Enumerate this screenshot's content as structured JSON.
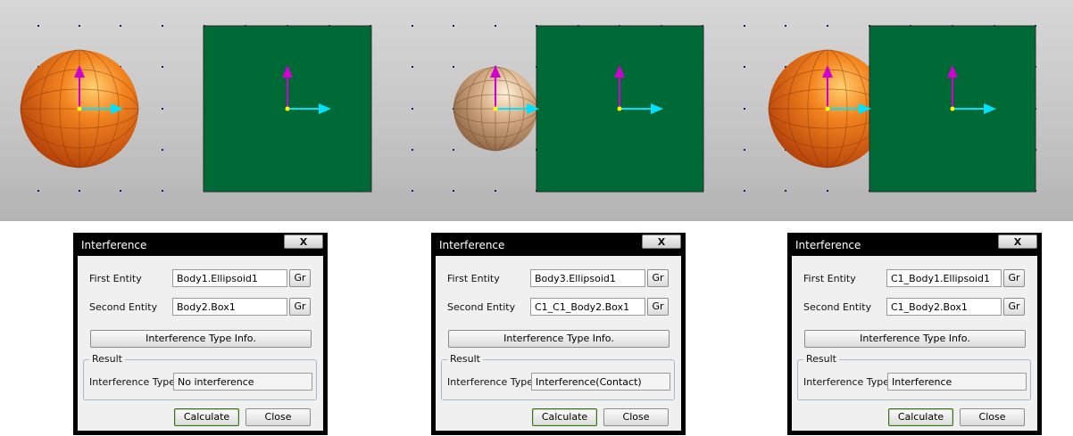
{
  "scene": {
    "colors": {
      "background_top": "#d7d7d7",
      "background_bottom": "#b3b3b3",
      "box_fill": "#006a37",
      "sphere_orange": "#e8681a",
      "sphere_tan": "#caa27a",
      "axis_x": "#00e0ff",
      "axis_y": "#d000d0",
      "origin": "#ffff00",
      "grid_dot": "#1a1a6a"
    },
    "panels": [
      {
        "name": "no-interference",
        "sphere_color": "orange",
        "relation": "separated"
      },
      {
        "name": "contact",
        "sphere_color": "tan",
        "relation": "touching"
      },
      {
        "name": "interference",
        "sphere_color": "orange",
        "relation": "overlapping"
      }
    ]
  },
  "dialogs": [
    {
      "title": "Interference",
      "close_label": "X",
      "first_entity_label": "First Entity",
      "first_entity_value": "Body1.Ellipsoid1",
      "second_entity_label": "Second Entity",
      "second_entity_value": "Body2.Box1",
      "gr_label": "Gr",
      "type_info_label": "Interference Type Info.",
      "result_legend": "Result",
      "interference_type_label": "Interference Type",
      "interference_type_value": "No interference",
      "calculate_label": "Calculate",
      "close_button_label": "Close"
    },
    {
      "title": "Interference",
      "close_label": "X",
      "first_entity_label": "First Entity",
      "first_entity_value": "Body3.Ellipsoid1",
      "second_entity_label": "Second Entity",
      "second_entity_value": "C1_C1_Body2.Box1",
      "gr_label": "Gr",
      "type_info_label": "Interference Type Info.",
      "result_legend": "Result",
      "interference_type_label": "Interference Type",
      "interference_type_value": "Interference(Contact)",
      "calculate_label": "Calculate",
      "close_button_label": "Close"
    },
    {
      "title": "Interference",
      "close_label": "X",
      "first_entity_label": "First Entity",
      "first_entity_value": "C1_Body1.Ellipsoid1",
      "second_entity_label": "Second Entity",
      "second_entity_value": "C1_Body2.Box1",
      "gr_label": "Gr",
      "type_info_label": "Interference Type Info.",
      "result_legend": "Result",
      "interference_type_label": "Interference Type",
      "interference_type_value": "Interference",
      "calculate_label": "Calculate",
      "close_button_label": "Close"
    }
  ]
}
